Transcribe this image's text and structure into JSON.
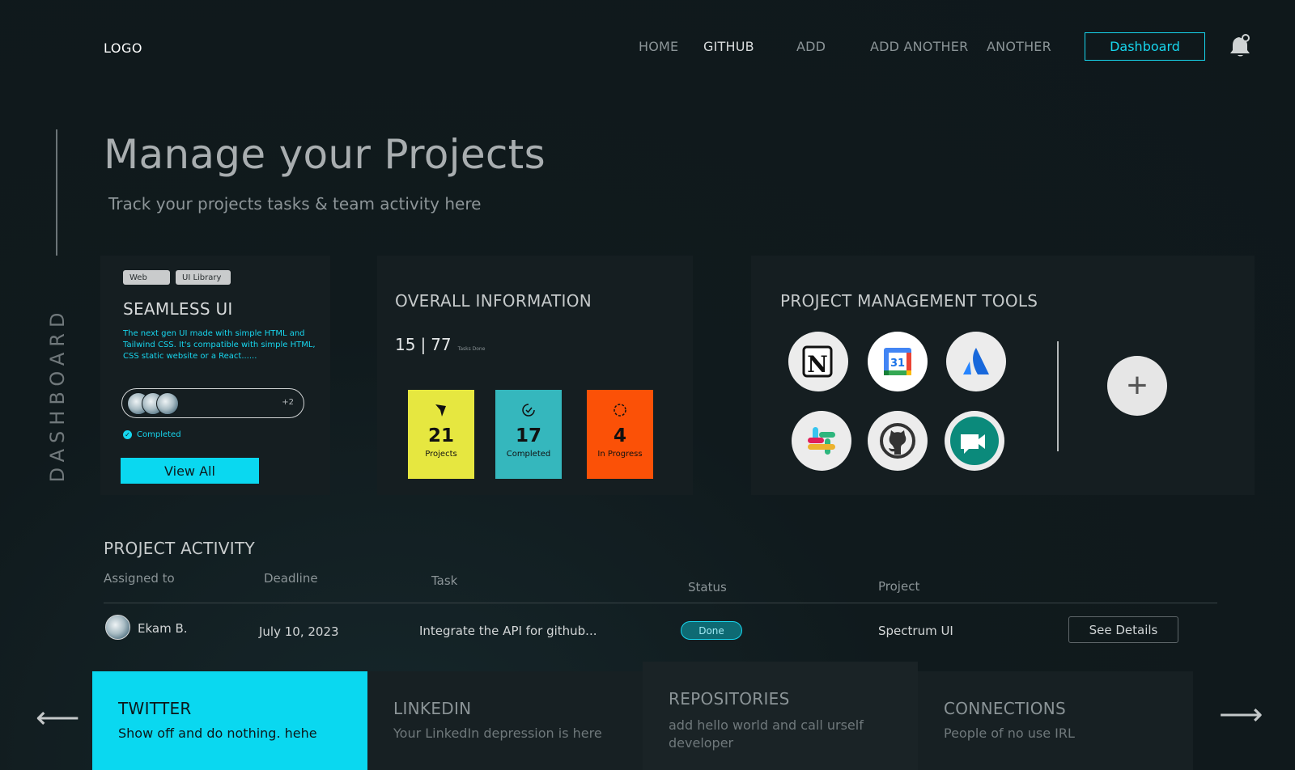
{
  "header": {
    "logo": "LOGO",
    "nav": [
      "HOME",
      "GITHUB",
      "ADD",
      "ADD ANOTHER",
      "ANOTHER"
    ],
    "active_nav": "GITHUB",
    "dashboard_button": "Dashboard",
    "icons": {
      "bell": "bell-icon"
    }
  },
  "sidebar": {
    "label": "DASHBOARD"
  },
  "hero": {
    "title": "Manage your Projects",
    "subtitle": "Track your projects tasks & team activity here"
  },
  "project_card": {
    "tags": [
      "Web",
      "UI Library"
    ],
    "title": "SEAMLESS UI",
    "description": "The next gen UI made with simple HTML and Tailwind CSS. It's compatible with simple HTML, CSS static website or a React......",
    "extra_members": "+2",
    "status": "Completed",
    "button": "View All"
  },
  "overall": {
    "title": "OVERALL INFORMATION",
    "done": "15",
    "total": "77",
    "done_label": "Tasks Done",
    "stats": [
      {
        "value": "21",
        "label": "Projects",
        "color": "#e6e740",
        "icon": "pen-nib-icon"
      },
      {
        "value": "17",
        "label": "Completed",
        "color": "#35b7bd",
        "icon": "clock-check-icon"
      },
      {
        "value": "4",
        "label": "In Progress",
        "color": "#fb5107",
        "icon": "spinner-icon"
      }
    ]
  },
  "tools": {
    "title": "PROJECT MANAGEMENT TOOLS",
    "items": [
      "notion-icon",
      "google-calendar-icon",
      "atlassian-icon",
      "slack-icon",
      "github-icon",
      "google-meet-icon"
    ],
    "calendar_day": "31",
    "add": "+"
  },
  "activity": {
    "title": "PROJECT ACTIVITY",
    "columns": [
      "Assigned to",
      "Deadline",
      "Task",
      "Status",
      "Project"
    ],
    "rows": [
      {
        "assignee": "Ekam B.",
        "deadline": "July 10, 2023",
        "task": "Integrate the API for github...",
        "status": "Done",
        "project": "Spectrum UI",
        "action": "See Details"
      }
    ]
  },
  "carousel": {
    "slides": [
      {
        "title": "TWITTER",
        "text": "Show off and do nothing. hehe"
      },
      {
        "title": "LINKEDIN",
        "text": "Your LinkedIn depression is here"
      },
      {
        "title": "REPOSITORIES",
        "text": "add hello world and call urself developer"
      },
      {
        "title": "CONNECTIONS",
        "text": "People of no use IRL"
      }
    ],
    "prev": "⟵",
    "next": "⟶"
  },
  "colors": {
    "accent": "#0ad8f0",
    "background": "#0f181b",
    "card": "#151e21"
  }
}
